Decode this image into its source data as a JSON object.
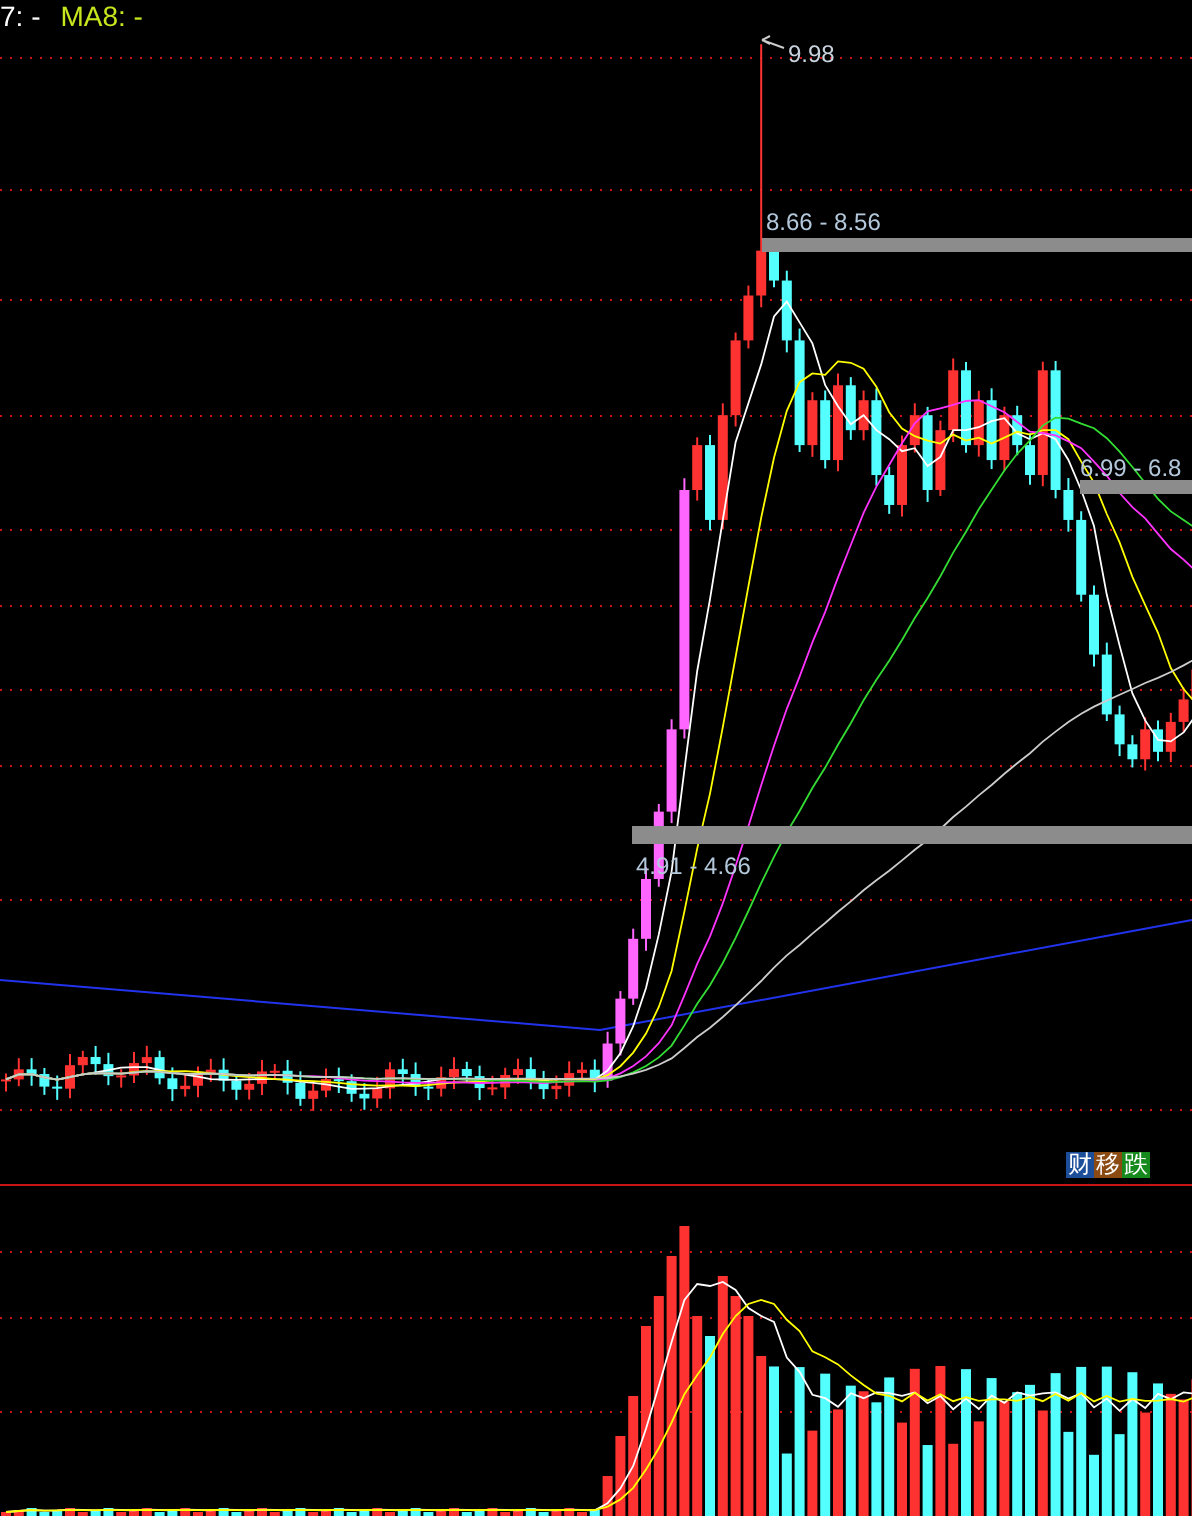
{
  "header": {
    "indicators": [
      {
        "label": "7: -",
        "color": "#ffffff"
      },
      {
        "label": "MA8: -",
        "color": "#c8e61e"
      }
    ]
  },
  "price_chart": {
    "annotations": [
      {
        "kind": "peak",
        "text": "9.98"
      },
      {
        "kind": "range",
        "text": "8.66 - 8.56"
      },
      {
        "kind": "range",
        "text": "6.99 - 6.8"
      },
      {
        "kind": "range",
        "text": "4.91 - 4.66"
      }
    ]
  },
  "signals": [
    {
      "text": "财",
      "color": "#1c4e9a"
    },
    {
      "text": "移",
      "color": "#8a4a12"
    },
    {
      "text": "跌",
      "color": "#178a1e"
    }
  ]
}
